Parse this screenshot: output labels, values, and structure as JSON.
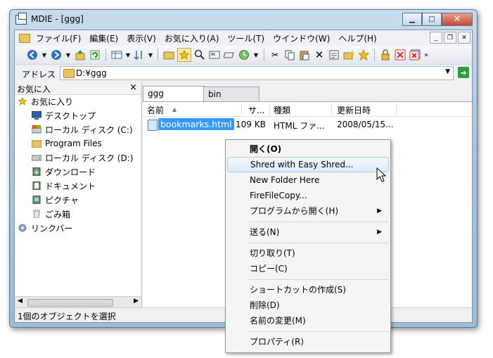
{
  "window": {
    "title": "MDIE - [ggg]"
  },
  "menubar": {
    "items": [
      "ファイル(F)",
      "編集(E)",
      "表示(V)",
      "お気に入り(A)",
      "ツール(T)",
      "ウインドウ(W)",
      "ヘルプ(H)"
    ]
  },
  "toolbar": {
    "icons": [
      "back-icon",
      "forward-icon",
      "up-icon",
      "refresh-icon",
      "views-icon",
      "sort-icon",
      "folder-icon",
      "favorites-icon",
      "search-icon",
      "preview-icon",
      "window-icon",
      "history-icon",
      "cut-icon",
      "copy-icon",
      "paste-icon",
      "delete-icon",
      "properties-icon",
      "new-folder-icon",
      "add-favorite-icon",
      "lock-icon",
      "close-tab-icon",
      "close-all-icon"
    ],
    "overflow": "»"
  },
  "address": {
    "label": "アドレス",
    "value": "D:¥ggg"
  },
  "favorites_pane": {
    "header": "お気に入",
    "close": "×",
    "items": [
      {
        "label": "お気に入り",
        "icon": "star-icon"
      },
      {
        "label": "デスクトップ",
        "icon": "desktop-icon"
      },
      {
        "label": "ローカル ディスク (C:)",
        "icon": "drive-icon"
      },
      {
        "label": "Program Files",
        "icon": "folder-icon"
      },
      {
        "label": "ローカル ディスク (D:)",
        "icon": "drive-icon"
      },
      {
        "label": "ダウンロード",
        "icon": "download-folder-icon"
      },
      {
        "label": "ドキュメント",
        "icon": "documents-folder-icon"
      },
      {
        "label": "ピクチャ",
        "icon": "pictures-folder-icon"
      },
      {
        "label": "ごみ箱",
        "icon": "recycle-bin-icon"
      },
      {
        "label": "リンクバー",
        "icon": "gear-icon"
      }
    ],
    "scroll_left": "◀",
    "scroll_right": "▶"
  },
  "tabs": [
    {
      "label": "ggg",
      "active": true
    },
    {
      "label": "bin",
      "active": false
    }
  ],
  "file_list": {
    "columns": [
      "名前",
      "サ...",
      "種類",
      "更新日時"
    ],
    "sort_indicator": "▲",
    "rows": [
      {
        "name": "bookmarks.html",
        "size": "109 KB",
        "type": "HTML ファ...",
        "modified": "2008/05/15..."
      }
    ]
  },
  "statusbar": {
    "text": "1個のオブジェクトを選択"
  },
  "context_menu": {
    "items": [
      {
        "label": "開く(O)",
        "bold": true
      },
      {
        "label": "Shred with Easy Shred...",
        "hot": true
      },
      {
        "label": "New Folder Here"
      },
      {
        "label": "FireFileCopy..."
      },
      {
        "label": "プログラムから開く(H)",
        "submenu": true
      },
      {
        "label": "送る(N)",
        "submenu": true
      },
      {
        "label": "切り取り(T)"
      },
      {
        "label": "コピー(C)"
      },
      {
        "label": "ショートカットの作成(S)"
      },
      {
        "label": "削除(D)"
      },
      {
        "label": "名前の変更(M)"
      },
      {
        "label": "プロパティ(R)"
      }
    ],
    "submenu_arrow": "▶"
  },
  "colors": {
    "selection": "#3399ff",
    "window_frame": "#aac6de"
  }
}
